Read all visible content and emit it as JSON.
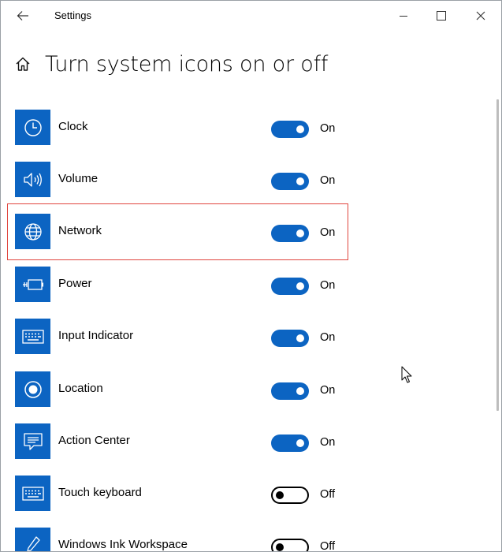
{
  "window": {
    "title": "Settings"
  },
  "page": {
    "title": "Turn system icons on or off"
  },
  "icons_list": [
    {
      "label": "Clock",
      "state": "On",
      "on": true,
      "icon": "clock-icon"
    },
    {
      "label": "Volume",
      "state": "On",
      "on": true,
      "icon": "volume-icon"
    },
    {
      "label": "Network",
      "state": "On",
      "on": true,
      "icon": "network-globe-icon"
    },
    {
      "label": "Power",
      "state": "On",
      "on": true,
      "icon": "battery-plug-icon"
    },
    {
      "label": "Input Indicator",
      "state": "On",
      "on": true,
      "icon": "keyboard-icon"
    },
    {
      "label": "Location",
      "state": "On",
      "on": true,
      "icon": "location-icon"
    },
    {
      "label": "Action Center",
      "state": "On",
      "on": true,
      "icon": "message-bubble-icon"
    },
    {
      "label": "Touch keyboard",
      "state": "Off",
      "on": false,
      "icon": "keyboard-icon"
    },
    {
      "label": "Windows Ink Workspace",
      "state": "Off",
      "on": false,
      "icon": "pen-icon"
    }
  ],
  "colors": {
    "accent": "#0c64c2",
    "highlight": "#e0463f"
  }
}
